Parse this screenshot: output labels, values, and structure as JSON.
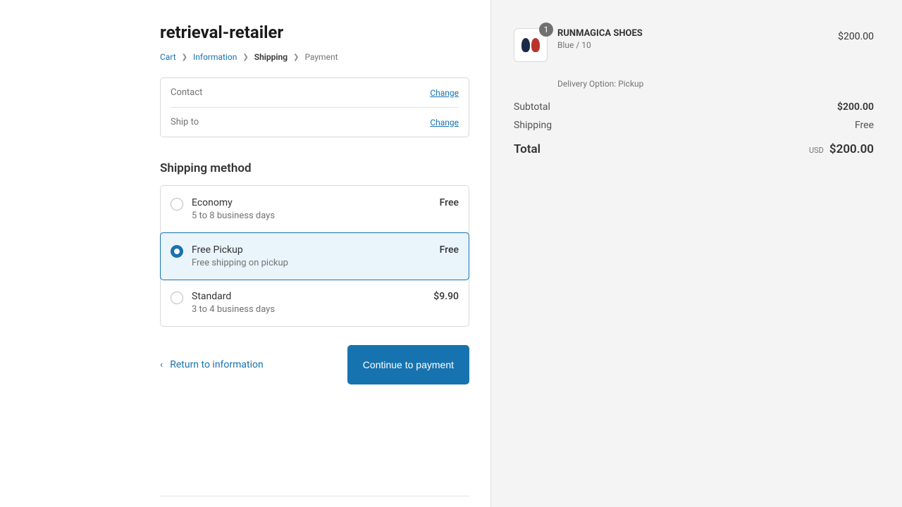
{
  "store": {
    "title": "retrieval-retailer"
  },
  "breadcrumb": {
    "cart": "Cart",
    "information": "Information",
    "shipping": "Shipping",
    "payment": "Payment"
  },
  "info": {
    "contact_label": "Contact",
    "contact_value": "",
    "shipto_label": "Ship to",
    "shipto_value": "",
    "change": "Change"
  },
  "shipping": {
    "heading": "Shipping method",
    "options": [
      {
        "name": "Economy",
        "desc": "5 to 8 business days",
        "price": "Free",
        "selected": false
      },
      {
        "name": "Free Pickup",
        "desc": "Free shipping on pickup",
        "price": "Free",
        "selected": true
      },
      {
        "name": "Standard",
        "desc": "3 to 4 business days",
        "price": "$9.90",
        "selected": false
      }
    ]
  },
  "actions": {
    "return": "Return to information",
    "continue": "Continue to payment"
  },
  "cart": {
    "qty": "1",
    "name": "RUNMAGICA SHOES",
    "variant": "Blue / 10",
    "price": "$200.00",
    "delivery_note": "Delivery Option: Pickup"
  },
  "summary": {
    "subtotal_label": "Subtotal",
    "subtotal_value": "$200.00",
    "shipping_label": "Shipping",
    "shipping_value": "Free",
    "total_label": "Total",
    "currency": "USD",
    "total_value": "$200.00"
  }
}
